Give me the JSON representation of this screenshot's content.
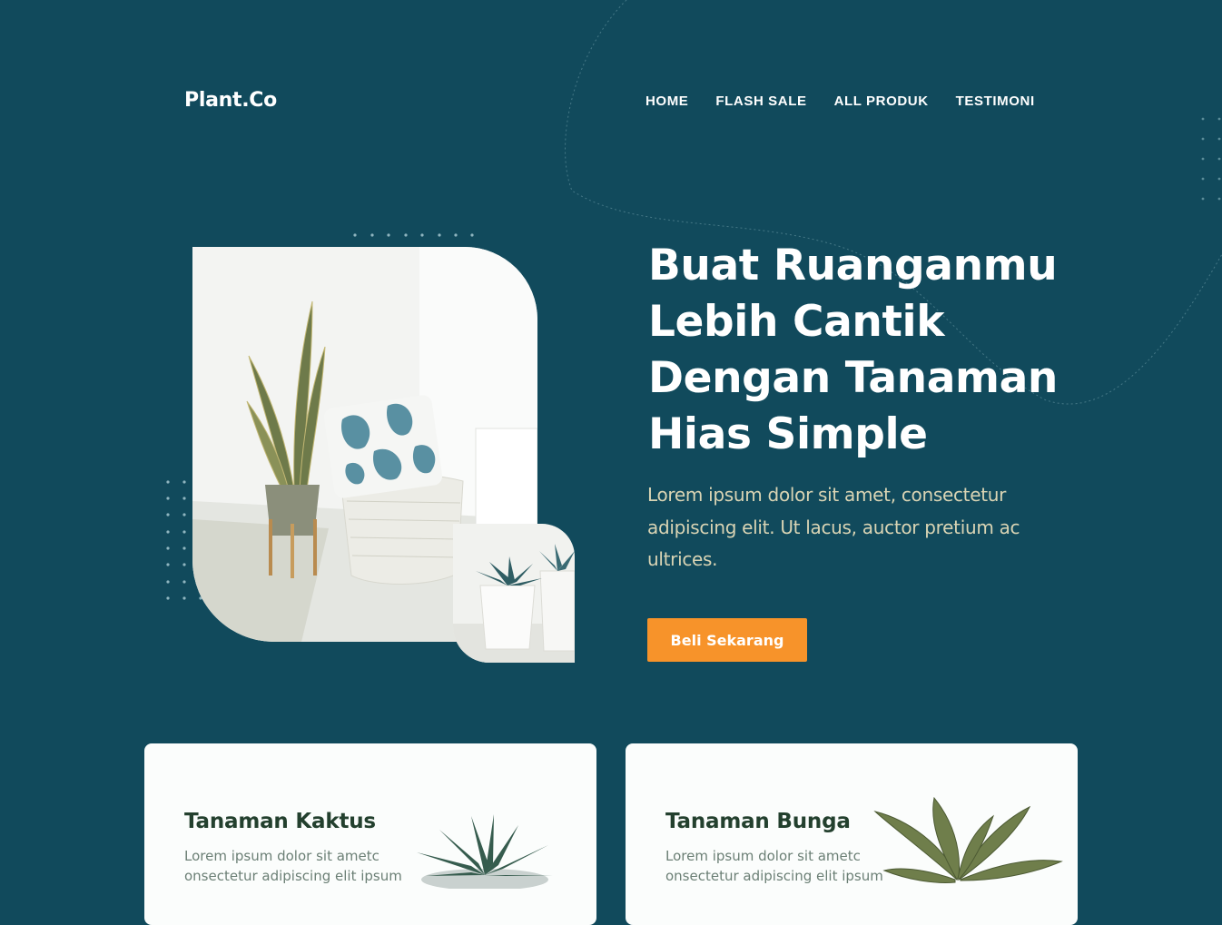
{
  "brand": {
    "logo": "Plant.Co"
  },
  "nav": {
    "items": [
      {
        "label": "HOME"
      },
      {
        "label": "FLASH SALE"
      },
      {
        "label": "ALL PRODUK"
      },
      {
        "label": "TESTIMONI"
      }
    ]
  },
  "hero": {
    "headline_lines": [
      "Buat Ruanganmu",
      "Lebih Cantik",
      "Dengan Tanaman",
      "Hias Simple"
    ],
    "description": "Lorem ipsum dolor sit amet, consectetur adipiscing elit. Ut lacus, auctor pretium ac ultrices.",
    "cta_label": "Beli Sekarang"
  },
  "categories": [
    {
      "title": "Tanaman Kaktus",
      "text": "Lorem ipsum dolor sit ametc onsectetur adipiscing elit ipsum"
    },
    {
      "title": "Tanaman Bunga",
      "text": "Lorem ipsum dolor sit ametc onsectetur adipiscing elit ipsum"
    }
  ],
  "colors": {
    "background": "#114a5c",
    "accent": "#f7932a",
    "text_light": "#ffffff",
    "text_muted": "#d9d4b4",
    "card_bg": "#fbfdfc",
    "card_title": "#23402e"
  }
}
